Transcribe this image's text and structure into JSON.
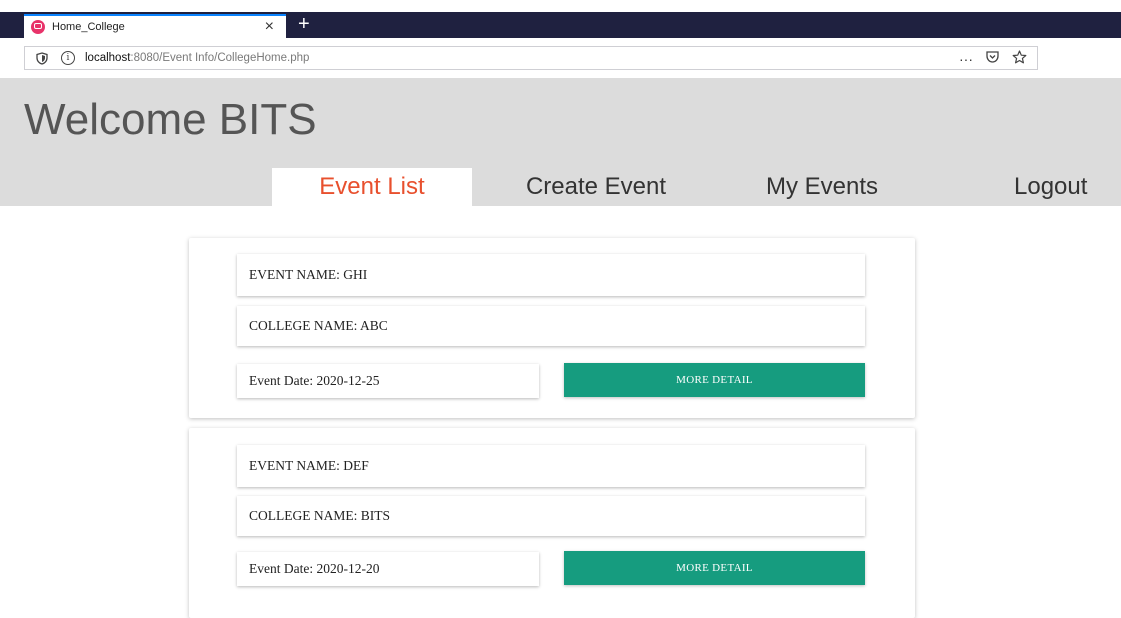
{
  "browser": {
    "tab_title": "Home_College",
    "tab_close": "×",
    "new_tab": "+",
    "url_host": "localhost",
    "url_path": ":8080/Event Info/CollegeHome.php",
    "menu_dots": "···",
    "colors": {
      "tabbar": "#1f2140",
      "accent": "#0a84ff"
    }
  },
  "header": {
    "welcome": "Welcome BITS",
    "nav": {
      "event_list": "Event List",
      "create_event": "Create Event",
      "my_events": "My Events",
      "logout": "Logout"
    },
    "colors": {
      "background": "#dcdcdc",
      "active": "#e8502e"
    }
  },
  "events": [
    {
      "event_name": "EVENT NAME: GHI",
      "college_name": "COLLEGE NAME: ABC",
      "event_date": "Event Date: 2020-12-25",
      "button_label": "MORE DETAIL"
    },
    {
      "event_name": "EVENT NAME: DEF",
      "college_name": "COLLEGE NAME: BITS",
      "event_date": "Event Date: 2020-12-20",
      "button_label": "MORE DETAIL"
    }
  ],
  "colors": {
    "button": "#169c7f"
  }
}
